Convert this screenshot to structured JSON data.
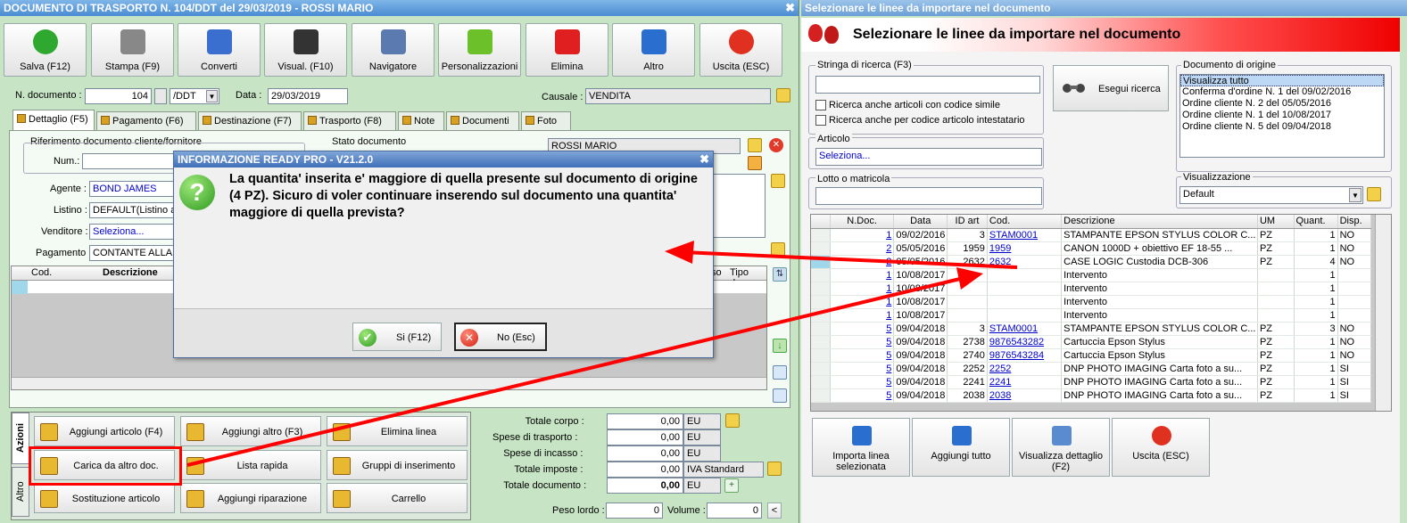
{
  "left_window": {
    "title": "DOCUMENTO DI TRASPORTO N. 104/DDT del 29/03/2019 - ROSSI MARIO",
    "toolbar": [
      {
        "label": "Salva (F12)",
        "icon": "check-icon",
        "color": "#2fa82f"
      },
      {
        "label": "Stampa (F9)",
        "icon": "printer-icon",
        "color": "#888888"
      },
      {
        "label": "Converti",
        "icon": "convert-icon",
        "color": "#3a6fd0"
      },
      {
        "label": "Visual. (F10)",
        "icon": "magic-wand-icon",
        "color": "#333333"
      },
      {
        "label": "Navigatore",
        "icon": "compass-icon",
        "color": "#5a7ab0"
      },
      {
        "label": "Personalizzazioni",
        "icon": "puzzle-icon",
        "color": "#6cc02a"
      },
      {
        "label": "Elimina",
        "icon": "delete-x-icon",
        "color": "#e02020"
      },
      {
        "label": "Altro",
        "icon": "magnifier-icon",
        "color": "#2a6fd0"
      },
      {
        "label": "Uscita (ESC)",
        "icon": "power-icon",
        "color": "#e03020"
      }
    ],
    "doc_number_label": "N. documento :",
    "doc_number": "104",
    "doc_series": "/DDT",
    "date_label": "Data :",
    "date": "29/03/2019",
    "causale_label": "Causale :",
    "causale": "VENDITA",
    "tabs": [
      "Dettaglio (F5)",
      "Pagamento (F6)",
      "Destinazione (F7)",
      "Trasporto (F8)",
      "Note",
      "Documenti",
      "Foto"
    ],
    "rif_label": "Riferimento documento cliente/fornitore",
    "num_label": "Num.:",
    "stato_label": "Stato documento",
    "cliente": "ROSSI MARIO",
    "agente_label": "Agente :",
    "agente": "BOND JAMES",
    "listino_label": "Listino :",
    "listino": "DEFAULT(Listino al",
    "venditore_label": "Venditore :",
    "venditore": "Seleziona...",
    "pagamento_label": "Pagamento :",
    "pagamento": "CONTANTE ALLA C",
    "grid_headers": [
      "Cod.",
      "Descrizione",
      "so",
      "Tipo doc."
    ],
    "side_tabs": [
      "Azioni",
      "Altro"
    ],
    "actions": [
      {
        "label": "Aggiungi articolo (F4)",
        "icon": "add-article-icon"
      },
      {
        "label": "Aggiungi altro (F3)",
        "icon": "add-other-icon"
      },
      {
        "label": "Elimina linea",
        "icon": "delete-line-icon"
      },
      {
        "label": "Carica da altro doc.",
        "icon": "load-doc-icon"
      },
      {
        "label": "Lista rapida",
        "icon": "quick-list-icon"
      },
      {
        "label": "Gruppi di inserimento",
        "icon": "groups-icon"
      },
      {
        "label": "Sostituzione articolo",
        "icon": "replace-icon"
      },
      {
        "label": "Aggiungi riparazione",
        "icon": "repair-icon"
      },
      {
        "label": "Carrello",
        "icon": "cart-icon"
      }
    ],
    "totals": [
      {
        "label": "Totale corpo :",
        "value": "0,00",
        "unit": "EU"
      },
      {
        "label": "Spese di trasporto :",
        "value": "0,00",
        "unit": "EU"
      },
      {
        "label": "Spese di incasso :",
        "value": "0,00",
        "unit": "EU"
      },
      {
        "label": "Totale imposte :",
        "value": "0,00",
        "unit": "IVA Standard"
      },
      {
        "label": "Totale documento :",
        "value": "0,00",
        "unit": "EU"
      }
    ],
    "peso_label": "Peso lordo :",
    "peso": "0",
    "volume_label": "Volume :",
    "volume": "0"
  },
  "dialog": {
    "title": "INFORMAZIONE READY PRO - V21.2.0",
    "message": "La quantita' inserita e' maggiore di quella presente sul documento di origine (4 PZ). Sicuro di voler continuare inserendo sul documento una quantita' maggiore di quella prevista?",
    "yes": "Si (F12)",
    "no": "No (Esc)"
  },
  "right_window": {
    "title": "Selezionare le linee da importare nel documento",
    "header": "Selezionare le linee da importare nel documento",
    "search_label": "Stringa di ricerca (F3)",
    "search_value": "",
    "check1": "Ricerca anche articoli con codice simile",
    "check2": "Ricerca anche per codice articolo intestatario",
    "search_button": "Esegui ricerca",
    "articolo_label": "Articolo",
    "articolo": "Seleziona...",
    "lotto_label": "Lotto o matricola",
    "origin_label": "Documento di origine",
    "origin_list": [
      "Visualizza tutto",
      "Conferma d'ordine N. 1 del 09/02/2016",
      "Ordine cliente N. 2 del 05/05/2016",
      "Ordine cliente N. 1 del 10/08/2017",
      "Ordine cliente N. 5 del 09/04/2018"
    ],
    "vis_label": "Visualizzazione",
    "vis_value": "Default",
    "columns": [
      "N.Doc.",
      "Data",
      "ID art",
      "Cod.",
      "Descrizione",
      "UM",
      "Quant.",
      "Disp."
    ],
    "rows": [
      [
        "1",
        "09/02/2016",
        "3",
        "STAM0001",
        "STAMPANTE EPSON STYLUS COLOR C...",
        "PZ",
        "1",
        "NO"
      ],
      [
        "2",
        "05/05/2016",
        "1959",
        "1959",
        "CANON 1000D + obiettivo EF 18-55 ...",
        "PZ",
        "1",
        "NO"
      ],
      [
        "2",
        "05/05/2016",
        "2632",
        "2632",
        "CASE LOGIC Custodia DCB-306",
        "PZ",
        "4",
        "NO"
      ],
      [
        "1",
        "10/08/2017",
        "",
        "",
        "Intervento",
        "",
        "1",
        ""
      ],
      [
        "1",
        "10/08/2017",
        "",
        "",
        "Intervento",
        "",
        "1",
        ""
      ],
      [
        "1",
        "10/08/2017",
        "",
        "",
        "Intervento",
        "",
        "1",
        ""
      ],
      [
        "1",
        "10/08/2017",
        "",
        "",
        "Intervento",
        "",
        "1",
        ""
      ],
      [
        "5",
        "09/04/2018",
        "3",
        "STAM0001",
        "STAMPANTE EPSON STYLUS COLOR C...",
        "PZ",
        "3",
        "NO"
      ],
      [
        "5",
        "09/04/2018",
        "2738",
        "9876543282",
        "Cartuccia Epson Stylus",
        "PZ",
        "1",
        "NO"
      ],
      [
        "5",
        "09/04/2018",
        "2740",
        "9876543284",
        "Cartuccia Epson Stylus",
        "PZ",
        "1",
        "NO"
      ],
      [
        "5",
        "09/04/2018",
        "2252",
        "2252",
        "DNP PHOTO IMAGING Carta foto a su...",
        "PZ",
        "1",
        "SI"
      ],
      [
        "5",
        "09/04/2018",
        "2241",
        "2241",
        "DNP PHOTO IMAGING Carta foto a su...",
        "PZ",
        "1",
        "SI"
      ],
      [
        "5",
        "09/04/2018",
        "2038",
        "2038",
        "DNP PHOTO IMAGING Carta foto a su...",
        "PZ",
        "1",
        "SI"
      ]
    ],
    "buttons": [
      {
        "label": "Importa linea selezionata",
        "icon": "import-line-icon"
      },
      {
        "label": "Aggiungi tutto",
        "icon": "add-all-icon"
      },
      {
        "label": "Visualizza dettaglio (F2)",
        "icon": "view-detail-icon"
      },
      {
        "label": "Uscita (ESC)",
        "icon": "exit-icon"
      }
    ]
  },
  "colors": {
    "window_bg": "#c7e5c5",
    "accent_red": "#ff0000",
    "title_blue": "#4a8bd2"
  }
}
